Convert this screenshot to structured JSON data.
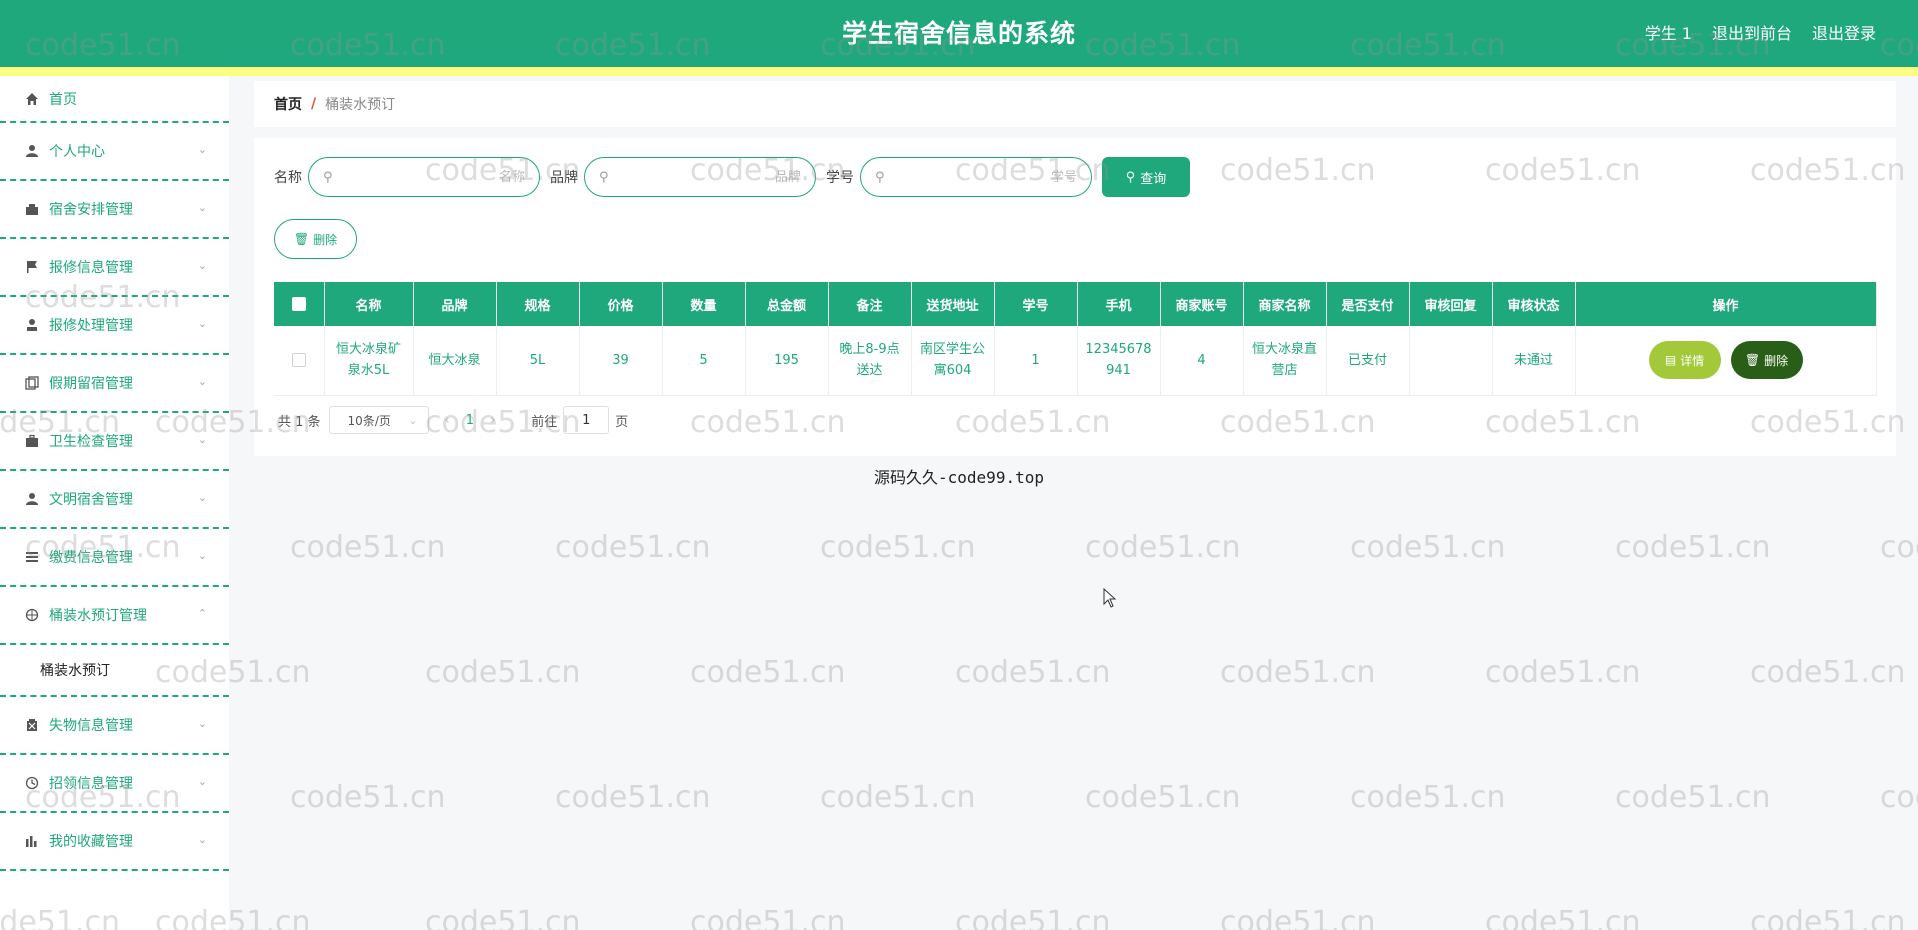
{
  "header": {
    "title": "学生宿舍信息的系统",
    "links": [
      "学生 1",
      "退出到前台",
      "退出登录"
    ]
  },
  "sidebar": {
    "items": [
      {
        "label": "首页",
        "icon": "home-icon"
      },
      {
        "label": "个人中心",
        "icon": "user-icon"
      },
      {
        "label": "宿舍安排管理",
        "icon": "cart-icon"
      },
      {
        "label": "报修信息管理",
        "icon": "flag-icon"
      },
      {
        "label": "报修处理管理",
        "icon": "user-lock-icon"
      },
      {
        "label": "假期留宿管理",
        "icon": "copy-icon"
      },
      {
        "label": "卫生检查管理",
        "icon": "suitcase-icon"
      },
      {
        "label": "文明宿舍管理",
        "icon": "person-icon"
      },
      {
        "label": "缴费信息管理",
        "icon": "list-icon"
      },
      {
        "label": "桶装水预订管理",
        "icon": "compass-icon"
      },
      {
        "label": "失物信息管理",
        "icon": "trash-icon"
      },
      {
        "label": "招领信息管理",
        "icon": "clock-icon"
      },
      {
        "label": "我的收藏管理",
        "icon": "chart-icon"
      }
    ],
    "sub_item": "桶装水预订"
  },
  "breadcrumb": {
    "home": "首页",
    "separator": "/",
    "current": "桶装水预订"
  },
  "search": {
    "fields": [
      {
        "label": "名称",
        "placeholder": "名称"
      },
      {
        "label": "品牌",
        "placeholder": "品牌"
      },
      {
        "label": "学号",
        "placeholder": "学号"
      }
    ],
    "query_label": "查询"
  },
  "toolbar": {
    "delete_label": "删除"
  },
  "table": {
    "headers": [
      "名称",
      "品牌",
      "规格",
      "价格",
      "数量",
      "总金额",
      "备注",
      "送货地址",
      "学号",
      "手机",
      "商家账号",
      "商家名称",
      "是否支付",
      "审核回复",
      "审核状态",
      "操作"
    ],
    "rows": [
      [
        "恒大冰泉矿泉水5L",
        "恒大冰泉",
        "5L",
        "39",
        "5",
        "195",
        "晚上8-9点送达",
        "南区学生公寓604",
        "1",
        "12345678941",
        "4",
        "恒大冰泉直营店",
        "已支付",
        "",
        "未通过"
      ]
    ],
    "actions": {
      "detail": "详情",
      "delete": "删除"
    }
  },
  "pagination": {
    "total": "共 1 条",
    "page_size": "10条/页",
    "current_page": "1",
    "goto_label": "前往",
    "goto_value": "1",
    "page_suffix": "页"
  },
  "footer": {
    "text": "源码久久-code99.top"
  },
  "watermark": {
    "text": "code51.cn"
  },
  "colors": {
    "primary": "#1ea87b",
    "stripe": "#fcfc80",
    "detail_button": "#a3c93a",
    "delete_button": "#285e15",
    "breadcrumb_separator": "#e2532d"
  }
}
